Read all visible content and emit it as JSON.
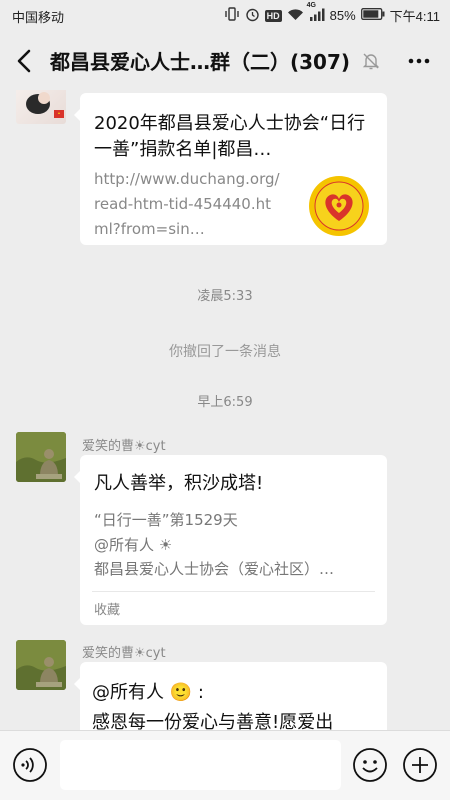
{
  "status_bar": {
    "carrier": "中国移动",
    "battery": "85%",
    "time": "下午4:11",
    "network": "4G",
    "hd": "HD"
  },
  "nav": {
    "title": "都昌县爱心人士…群（二）(307)"
  },
  "messages": {
    "link_card": {
      "title": "2020年都昌县爱心人士协会“日行一善”捐款名单|都昌…",
      "url": "http://www.duchang.org/read-htm-tid-454440.html?from=sin…"
    },
    "time_1": "凌晨5:33",
    "system": "你撤回了一条消息",
    "time_2": "早上6:59",
    "msg1": {
      "sender": "爱笑的曹☀cyt",
      "title": "凡人善举，积沙成塔!",
      "line1": "“日行一善”第1529天",
      "line2": "@所有人 ☀",
      "line3": "都昌县爱心人士协会（爱心社区）…",
      "footer": "收藏"
    },
    "msg2": {
      "sender": "爱笑的曹☀cyt",
      "line1": "@所有人 🙂 :",
      "line2": "感恩每一份爱心与善意!愿爱出"
    }
  },
  "icons": {
    "back": "back-arrow-icon",
    "mute": "mute-bell-icon",
    "more": "more-dots-icon",
    "voice": "voice-icon",
    "emoji": "emoji-icon",
    "plus": "plus-icon"
  },
  "colors": {
    "background": "#ededed",
    "bubble": "#ffffff",
    "meta_text": "#888888"
  }
}
